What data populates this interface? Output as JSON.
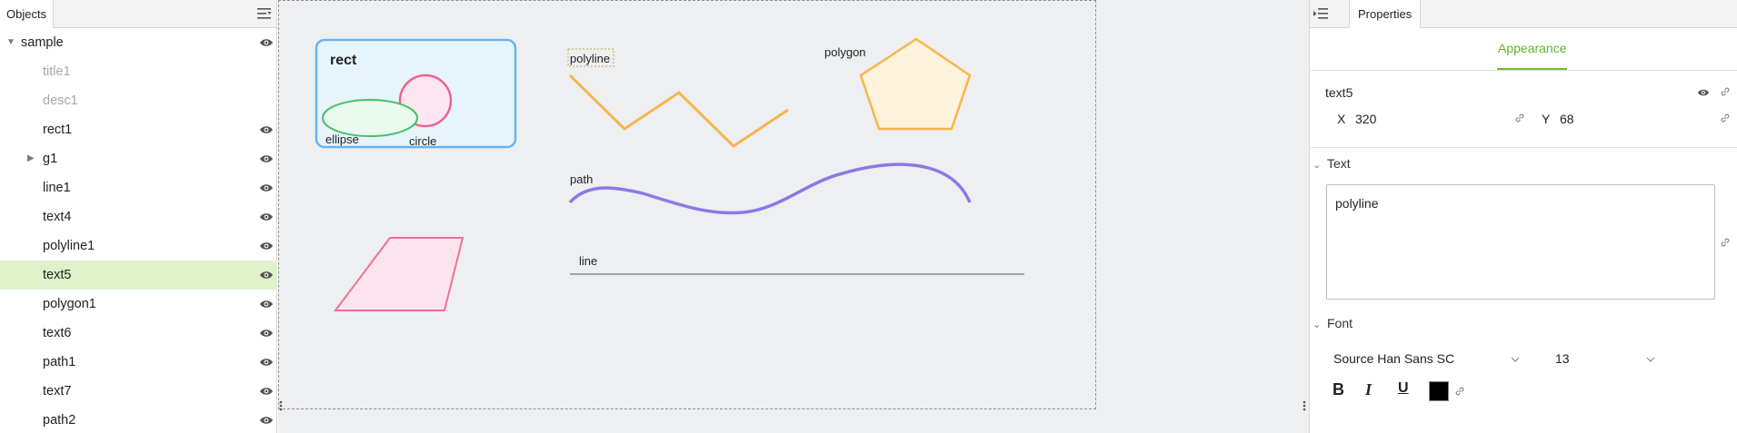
{
  "objects_panel": {
    "tab_label": "Objects",
    "tree": [
      {
        "label": "sample",
        "dim": false,
        "indent": 0,
        "caret": "expanded",
        "eye": true,
        "selected": false
      },
      {
        "label": "title1",
        "dim": true,
        "indent": 1,
        "caret": "",
        "eye": false,
        "selected": false
      },
      {
        "label": "desc1",
        "dim": true,
        "indent": 1,
        "caret": "",
        "eye": false,
        "selected": false
      },
      {
        "label": "rect1",
        "dim": false,
        "indent": 1,
        "caret": "",
        "eye": true,
        "selected": false
      },
      {
        "label": "g1",
        "dim": false,
        "indent": 1,
        "caret": "collapsed",
        "eye": true,
        "selected": false
      },
      {
        "label": "line1",
        "dim": false,
        "indent": 1,
        "caret": "",
        "eye": true,
        "selected": false
      },
      {
        "label": "text4",
        "dim": false,
        "indent": 1,
        "caret": "",
        "eye": true,
        "selected": false
      },
      {
        "label": "polyline1",
        "dim": false,
        "indent": 1,
        "caret": "",
        "eye": true,
        "selected": false
      },
      {
        "label": "text5",
        "dim": false,
        "indent": 1,
        "caret": "",
        "eye": true,
        "selected": true
      },
      {
        "label": "polygon1",
        "dim": false,
        "indent": 1,
        "caret": "",
        "eye": true,
        "selected": false
      },
      {
        "label": "text6",
        "dim": false,
        "indent": 1,
        "caret": "",
        "eye": true,
        "selected": false
      },
      {
        "label": "path1",
        "dim": false,
        "indent": 1,
        "caret": "",
        "eye": true,
        "selected": false
      },
      {
        "label": "text7",
        "dim": false,
        "indent": 1,
        "caret": "",
        "eye": true,
        "selected": false
      },
      {
        "label": "path2",
        "dim": false,
        "indent": 1,
        "caret": "",
        "eye": true,
        "selected": false
      }
    ]
  },
  "canvas": {
    "labels": {
      "rect": "rect",
      "ellipse": "ellipse",
      "circle": "circle",
      "polyline": "polyline",
      "polygon": "polygon",
      "path": "path",
      "line": "line"
    },
    "colors": {
      "rect_stroke": "#6bb2ec",
      "rect_fill": "#e6f4fc",
      "circle_stroke": "#ea6494",
      "circle_fill": "#fde6ef",
      "ellipse_stroke": "#4bc06a",
      "ellipse_fill": "#eafaee",
      "polyline_stroke": "#f5b64d",
      "polygon_stroke": "#f5b64d",
      "polygon_fill": "#fff3dc",
      "path_stroke": "#8d78e6",
      "parallelogram_stroke": "#ee6f99",
      "parallelogram_fill": "#fde4ee",
      "line_stroke": "#9aa5b1",
      "selection_box": "#c8a24a"
    }
  },
  "properties_panel": {
    "tab_label": "Properties",
    "subtab": "Appearance",
    "object_name": "text5",
    "x_label": "X",
    "x_value": "320",
    "y_label": "Y",
    "y_value": "68",
    "text_section": "Text",
    "text_value": "polyline",
    "font_section": "Font",
    "font_family": "Source Han Sans SC",
    "font_size": "13",
    "bold_label": "B",
    "italic_label": "I",
    "underline_label": "U",
    "text_color": "#000000"
  },
  "icons": {
    "objects_menu": "list-menu-icon",
    "eye": "eye-icon",
    "link": "link-icon",
    "collapse": "panel-collapse-icon",
    "chevron": "chevron-down-icon"
  }
}
